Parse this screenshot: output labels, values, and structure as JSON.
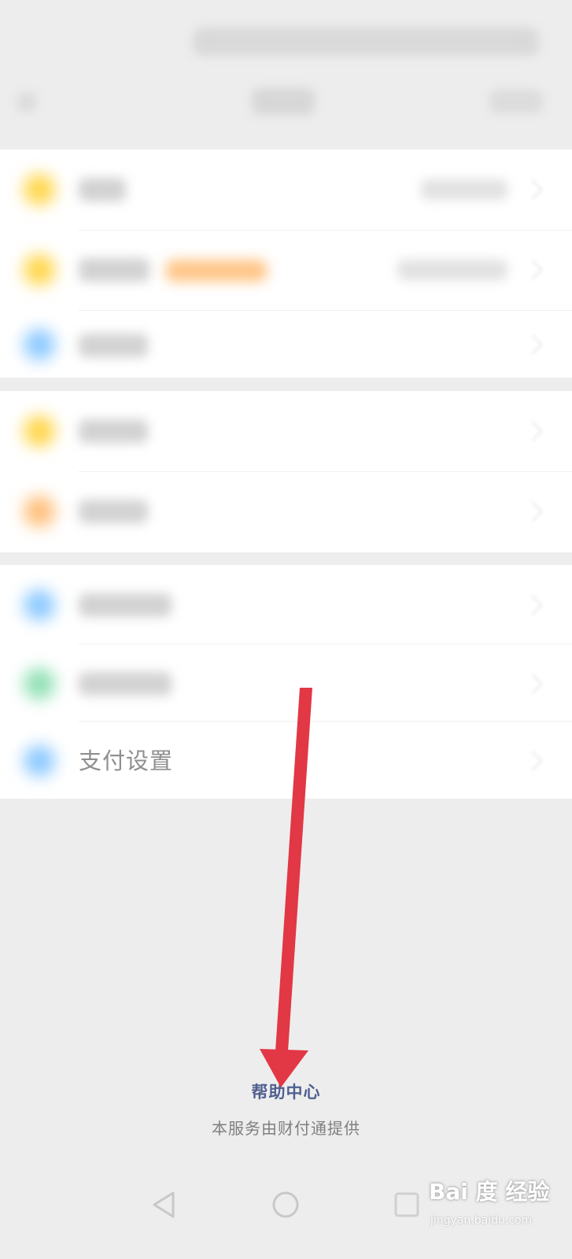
{
  "settings": {
    "pay_settings_label": "支付设置"
  },
  "footer": {
    "help_center": "帮助中心",
    "provider": "本服务由财付通提供"
  },
  "watermark": {
    "brand": "Bai 度 经验",
    "url": "jingyan.baidu.com"
  },
  "icons": {
    "back": "triangle-back-icon",
    "home": "circle-home-icon",
    "recent": "square-recent-icon",
    "chevron": "chevron-right-icon"
  },
  "colors": {
    "page_bg": "#ededed",
    "card_bg": "#ffffff",
    "help_link": "#4f5f8f",
    "arrow": "#e23744"
  }
}
